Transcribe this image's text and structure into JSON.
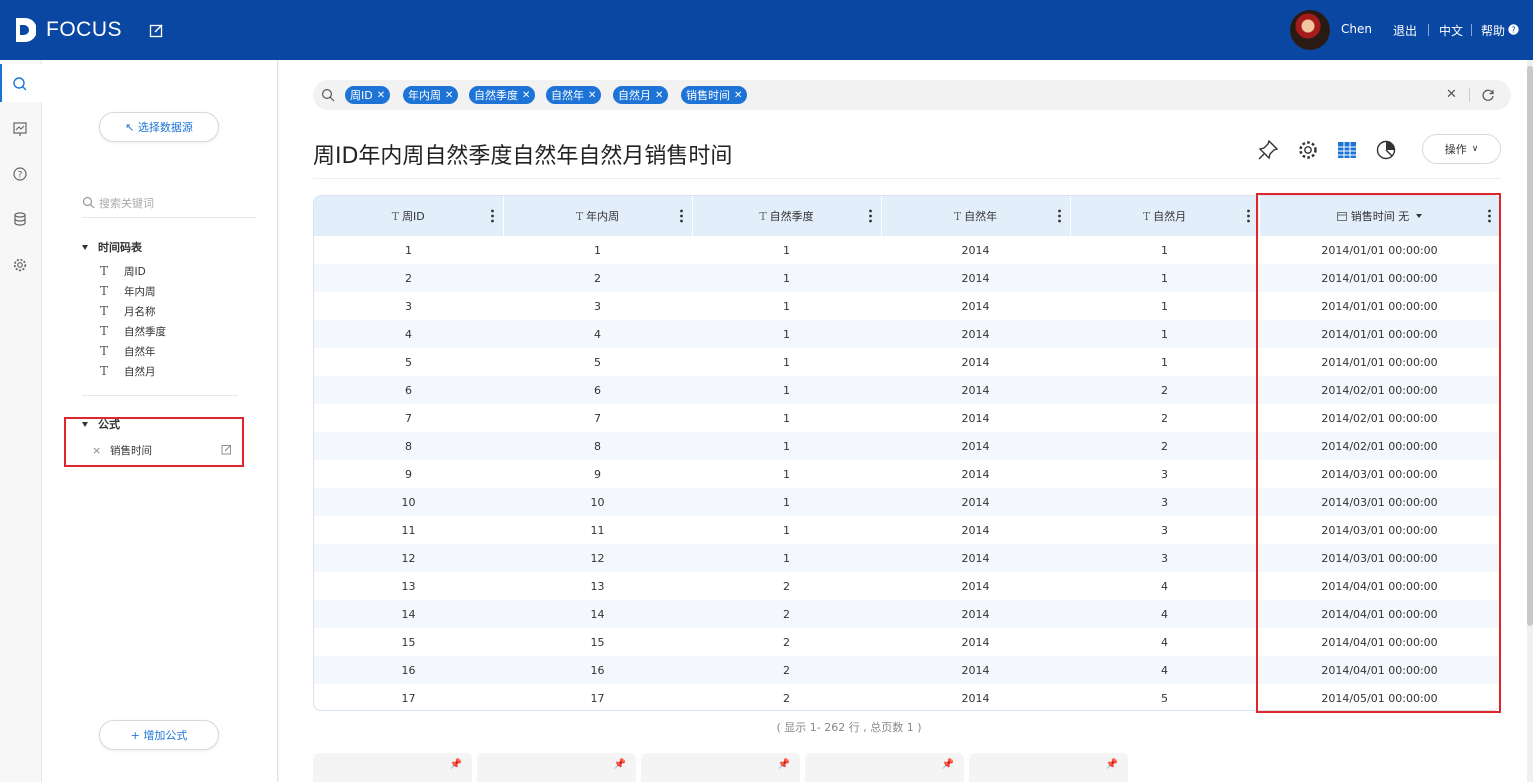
{
  "app": {
    "logo_text": "FOCUS"
  },
  "topbar": {
    "user_name": "Chen",
    "logout": "退出",
    "language": "中文",
    "help": "帮助"
  },
  "left": {
    "select_source": "↖ 选择数据源",
    "keyword_placeholder": "搜索关键词",
    "table_name": "时间码表",
    "fields": [
      "周ID",
      "年内周",
      "月名称",
      "自然季度",
      "自然年",
      "自然月"
    ],
    "formula_section": "公式",
    "formula_item": "销售时间",
    "add_formula": "+ 增加公式"
  },
  "search": {
    "chips": [
      "周ID",
      "年内周",
      "自然季度",
      "自然年",
      "自然月",
      "销售时间"
    ]
  },
  "page_title": "周ID年内周自然季度自然年自然月销售时间",
  "operate_label": "操作",
  "table": {
    "columns": [
      "周ID",
      "年内周",
      "自然季度",
      "自然年",
      "自然月",
      "销售时间 无"
    ],
    "rows": [
      [
        "1",
        "1",
        "1",
        "2014",
        "1",
        "2014/01/01 00:00:00"
      ],
      [
        "2",
        "2",
        "1",
        "2014",
        "1",
        "2014/01/01 00:00:00"
      ],
      [
        "3",
        "3",
        "1",
        "2014",
        "1",
        "2014/01/01 00:00:00"
      ],
      [
        "4",
        "4",
        "1",
        "2014",
        "1",
        "2014/01/01 00:00:00"
      ],
      [
        "5",
        "5",
        "1",
        "2014",
        "1",
        "2014/01/01 00:00:00"
      ],
      [
        "6",
        "6",
        "1",
        "2014",
        "2",
        "2014/02/01 00:00:00"
      ],
      [
        "7",
        "7",
        "1",
        "2014",
        "2",
        "2014/02/01 00:00:00"
      ],
      [
        "8",
        "8",
        "1",
        "2014",
        "2",
        "2014/02/01 00:00:00"
      ],
      [
        "9",
        "9",
        "1",
        "2014",
        "3",
        "2014/03/01 00:00:00"
      ],
      [
        "10",
        "10",
        "1",
        "2014",
        "3",
        "2014/03/01 00:00:00"
      ],
      [
        "11",
        "11",
        "1",
        "2014",
        "3",
        "2014/03/01 00:00:00"
      ],
      [
        "12",
        "12",
        "1",
        "2014",
        "3",
        "2014/03/01 00:00:00"
      ],
      [
        "13",
        "13",
        "2",
        "2014",
        "4",
        "2014/04/01 00:00:00"
      ],
      [
        "14",
        "14",
        "2",
        "2014",
        "4",
        "2014/04/01 00:00:00"
      ],
      [
        "15",
        "15",
        "2",
        "2014",
        "4",
        "2014/04/01 00:00:00"
      ],
      [
        "16",
        "16",
        "2",
        "2014",
        "4",
        "2014/04/01 00:00:00"
      ],
      [
        "17",
        "17",
        "2",
        "2014",
        "5",
        "2014/05/01 00:00:00"
      ]
    ],
    "footer": "( 显示 1- 262 行 , 总页数 1 )"
  },
  "colors": {
    "brand": "#0a47a3",
    "accent": "#1d74d6",
    "highlight": "#e0262b"
  }
}
